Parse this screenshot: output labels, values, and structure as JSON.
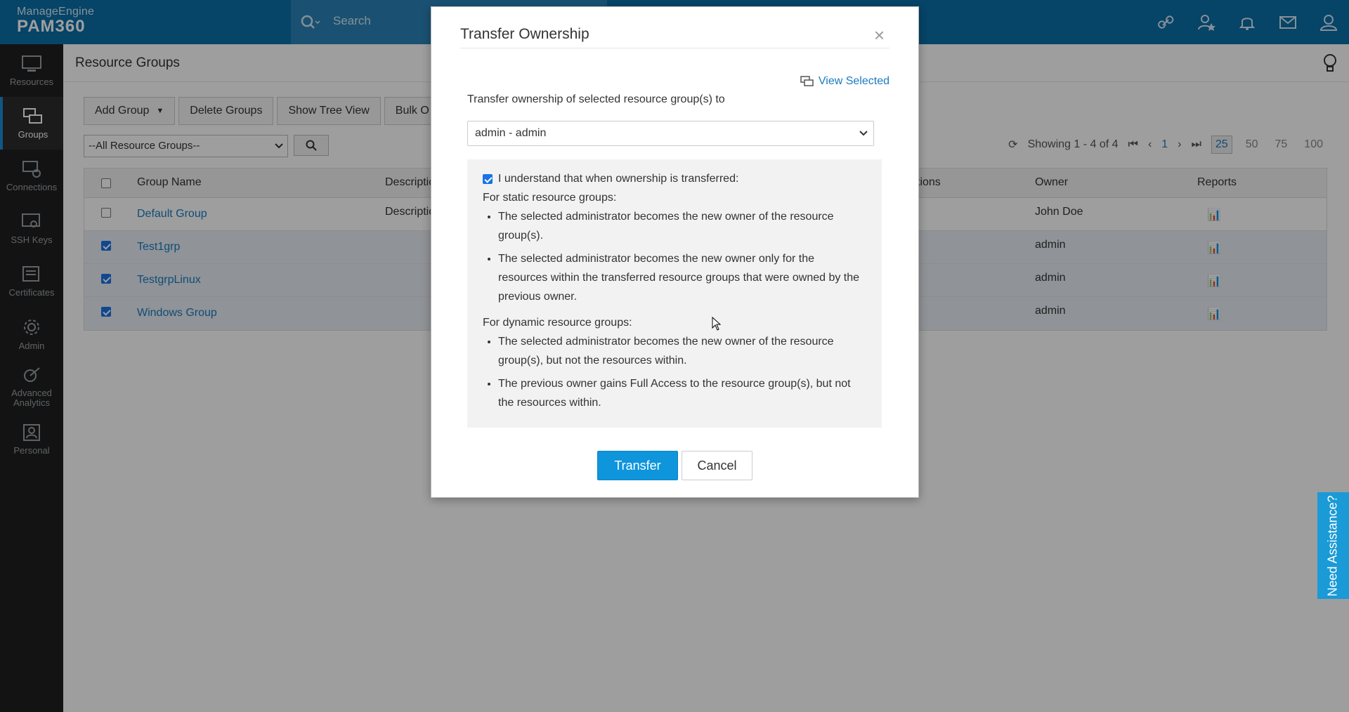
{
  "topbar": {
    "brand": "ManageEngine",
    "product": "PAM360",
    "search_placeholder": "Search"
  },
  "nav": {
    "items": [
      {
        "label": "Resources"
      },
      {
        "label": "Groups"
      },
      {
        "label": "Connections"
      },
      {
        "label": "SSH Keys"
      },
      {
        "label": "Certificates"
      },
      {
        "label": "Admin"
      },
      {
        "label": "Advanced Analytics"
      },
      {
        "label": "Personal"
      }
    ]
  },
  "page": {
    "title": "Resource Groups",
    "toolbar": {
      "add_group": "Add Group",
      "delete_groups": "Delete Groups",
      "show_tree_view": "Show Tree View",
      "bulk": "Bulk O"
    },
    "filter_value": "--All Resource Groups--",
    "pager": {
      "showing": "Showing 1 - 4 of 4",
      "page": "1",
      "sizes": [
        "25",
        "50",
        "75",
        "100"
      ],
      "selected_size": "25"
    },
    "table": {
      "headers": {
        "name": "Group Name",
        "description": "Descriptio",
        "actions": "tions",
        "owner": "Owner",
        "reports": "Reports"
      },
      "rows": [
        {
          "name": "Default Group",
          "description": "Descriptio",
          "owner": "John Doe",
          "selected": false
        },
        {
          "name": "Test1grp",
          "description": "",
          "owner": "admin",
          "selected": true
        },
        {
          "name": "TestgrpLinux",
          "description": "",
          "owner": "admin",
          "selected": true
        },
        {
          "name": "Windows Group",
          "description": "",
          "owner": "admin",
          "selected": true
        }
      ]
    }
  },
  "modal": {
    "title": "Transfer Ownership",
    "close": "×",
    "view_selected": "View Selected",
    "transfer_label": "Transfer ownership of selected resource group(s) to",
    "owner_value": "admin - admin",
    "ack_label": "I understand that when ownership is transferred:",
    "static_heading": "For static resource groups:",
    "static_points": [
      "The selected administrator becomes the new owner of the resource group(s).",
      "The selected administrator becomes the new owner only for the resources within the transferred resource groups that were owned by the previous owner."
    ],
    "dynamic_heading": "For dynamic resource groups:",
    "dynamic_points": [
      "The selected administrator becomes the new owner of the resource group(s), but not the resources within.",
      "The previous owner gains Full Access to the resource group(s), but not the resources within."
    ],
    "transfer_button": "Transfer",
    "cancel_button": "Cancel"
  },
  "assistance": "Need Assistance?",
  "colors": {
    "topbar": "#0b6fa8",
    "accent": "#0e95dc",
    "nav_bg": "#1f1f1f"
  }
}
